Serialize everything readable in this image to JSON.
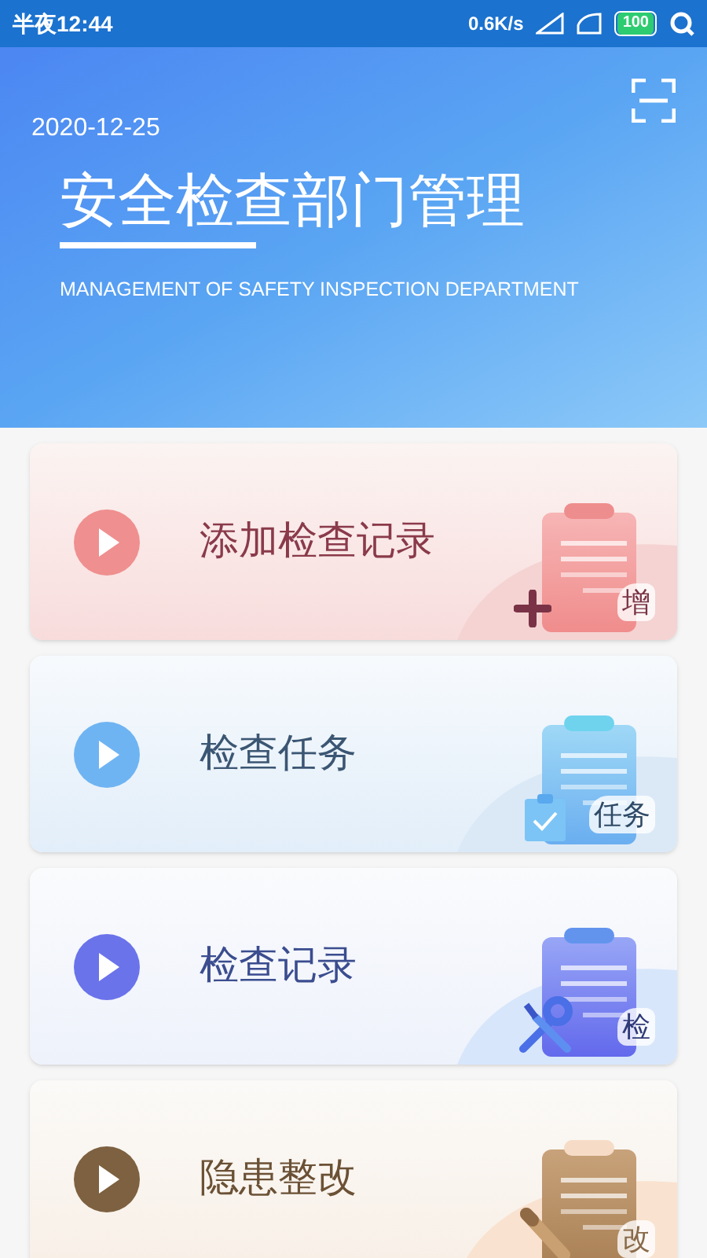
{
  "status_bar": {
    "time": "半夜12:44",
    "speed": "0.6K/s",
    "battery": "100"
  },
  "header": {
    "date": "2020-12-25",
    "title": "安全检查部门管理",
    "subtitle": "MANAGEMENT OF SAFETY INSPECTION DEPARTMENT"
  },
  "cards": [
    {
      "kind": "add",
      "label": "添加检查记录",
      "badge": "增",
      "color": "#ef8f8f"
    },
    {
      "kind": "task",
      "label": "检查任务",
      "badge": "任务",
      "color": "#6fb4f2"
    },
    {
      "kind": "check",
      "label": "检查记录",
      "badge": "检",
      "color": "#6a73ea"
    },
    {
      "kind": "fix",
      "label": "隐患整改",
      "badge": "改",
      "color": "#7d6140"
    }
  ]
}
